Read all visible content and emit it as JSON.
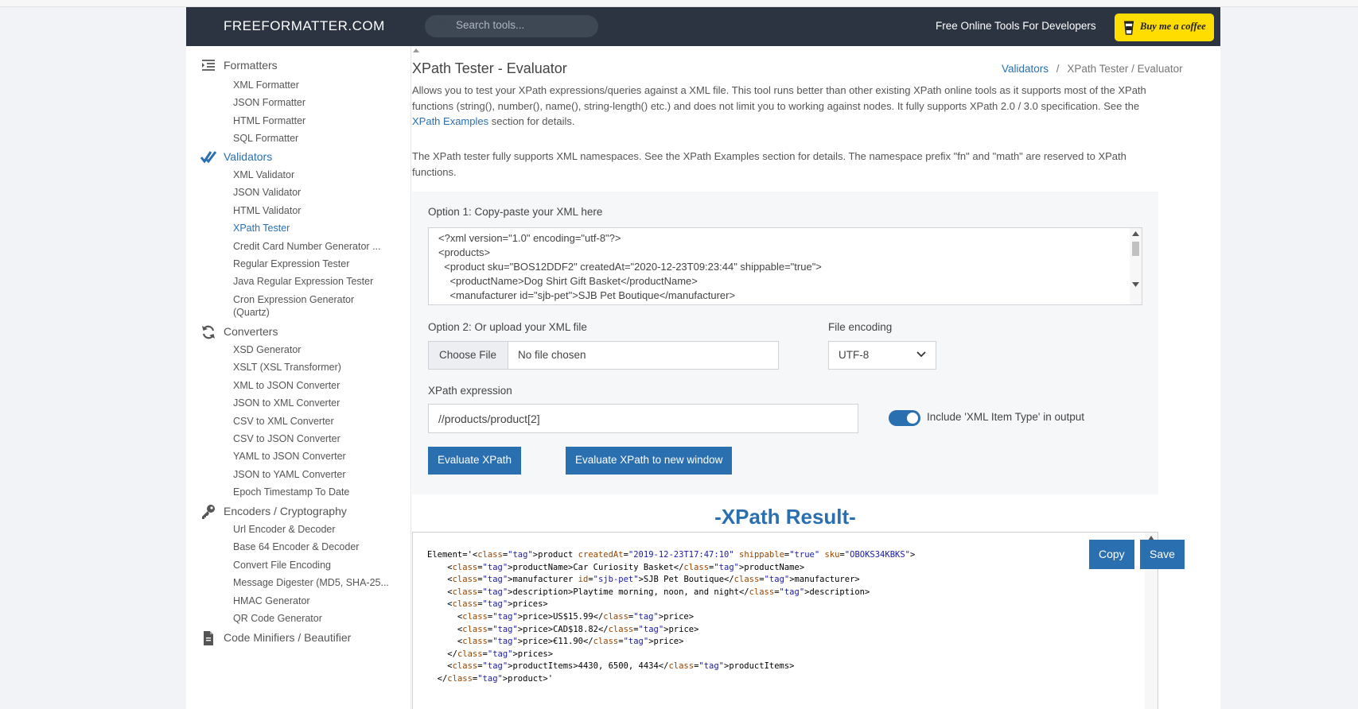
{
  "header": {
    "logo": "FREEFORMATTER.COM",
    "search_placeholder": "Search tools...",
    "tagline": "Free Online Tools For Developers",
    "coffee_label": "Buy me a coffee"
  },
  "sidebar": {
    "categories": [
      {
        "label": "Formatters",
        "icon": "indent-list-icon",
        "items": [
          "XML Formatter",
          "JSON Formatter",
          "HTML Formatter",
          "SQL Formatter"
        ]
      },
      {
        "label": "Validators",
        "icon": "double-check-icon",
        "items": [
          "XML Validator",
          "JSON Validator",
          "HTML Validator",
          "XPath Tester",
          "Credit Card Number Generator ...",
          "Regular Expression Tester",
          "Java Regular Expression Tester",
          "Cron Expression Generator",
          "(Quartz)"
        ]
      },
      {
        "label": "Converters",
        "icon": "refresh-icon",
        "items": [
          "XSD Generator",
          "XSLT (XSL Transformer)",
          "XML to JSON Converter",
          "JSON to XML Converter",
          "CSV to XML Converter",
          "CSV to JSON Converter",
          "YAML to JSON Converter",
          "JSON to YAML Converter",
          "Epoch Timestamp To Date"
        ]
      },
      {
        "label": "Encoders / Cryptography",
        "icon": "key-icon",
        "items": [
          "Url Encoder & Decoder",
          "Base 64 Encoder & Decoder",
          "Convert File Encoding",
          "Message Digester (MD5, SHA-25...",
          "HMAC Generator",
          "QR Code Generator"
        ]
      },
      {
        "label": "Code Minifiers / Beautifier",
        "icon": "file-icon",
        "items": []
      }
    ]
  },
  "main": {
    "title": "XPath Tester - Evaluator",
    "breadcrumb": {
      "link": "Validators",
      "sep": "/",
      "current": "XPath Tester / Evaluator"
    },
    "para1_a": "Allows you to test your XPath expressions/queries against a XML file. This tool runs better than other existing XPath online tools as it supports most of the XPath functions (string(), number(), name(), string-length() etc.) and does not limit you to working against nodes. It fully supports XPath 2.0 / 3.0 specification. See the ",
    "para1_link": "XPath Examples",
    "para1_b": " section for details.",
    "para2": "The XPath tester fully supports XML namespaces. See the XPath Examples section for details. The namespace prefix \"fn\" and \"math\" are reserved to XPath functions.",
    "option1_label": "Option 1: Copy-paste your XML here",
    "xml_lines": [
      "<?xml version=\"1.0\" encoding=\"utf-8\"?>",
      "<products>",
      "  <product sku=\"BOS12DDF2\" createdAt=\"2020-12-23T09:23:44\" shippable=\"true\">",
      "    <productName>Dog Shirt Gift Basket</productName>",
      "    <manufacturer id=\"sjb-pet\">SJB Pet Boutique</manufacturer>"
    ],
    "option2_label": "Option 2: Or upload your XML file",
    "choose_file": "Choose File",
    "no_file": "No file chosen",
    "encoding_label": "File encoding",
    "encoding_value": "UTF-8",
    "xpath_label": "XPath expression",
    "xpath_value": "//products/product[2]",
    "toggle_label": "Include 'XML Item Type' in output",
    "toggle_on": true,
    "evaluate_btn": "Evaluate XPath",
    "evaluate_new_btn": "Evaluate XPath to new window",
    "result_title": "-XPath Result-",
    "copy_btn": "Copy",
    "save_btn": "Save",
    "result_lines": [
      "Element='<product createdAt=\"2019-12-23T17:47:10\" shippable=\"true\" sku=\"OBOKS34KBKS\">",
      "    <productName>Car Curiosity Basket</productName>",
      "    <manufacturer id=\"sjb-pet\">SJB Pet Boutique</manufacturer>",
      "    <description>Playtime morning, noon, and night</description>",
      "    <prices>",
      "      <price>US$15.99</price>",
      "      <price>CAD$18.82</price>",
      "      <price>€11.90</price>",
      "    </prices>",
      "    <productItems>4430, 6500, 4434</productItems>",
      "  </product>'"
    ]
  },
  "colors": {
    "accent": "#2a6fb0",
    "header_bg": "#2b3440",
    "coffee": "#ffdd00"
  }
}
